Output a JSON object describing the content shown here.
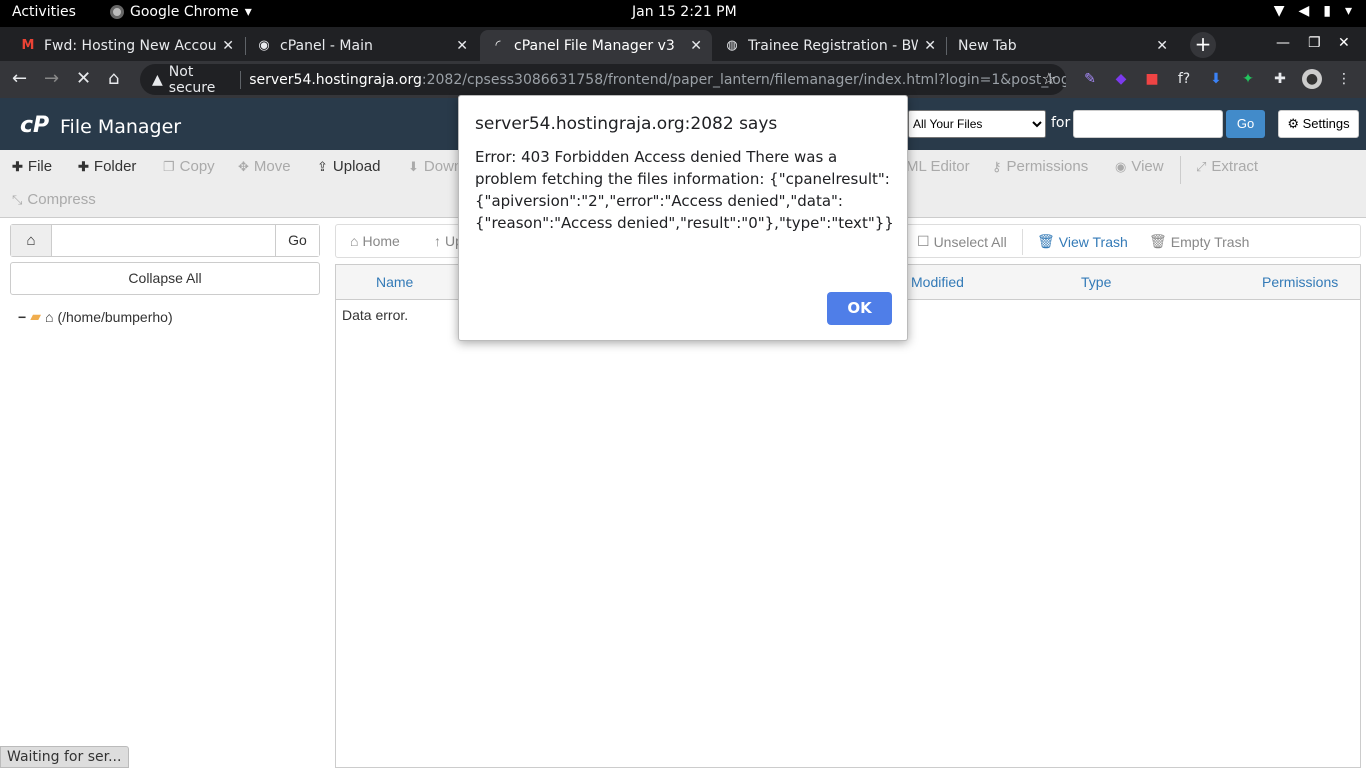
{
  "os": {
    "activities": "Activities",
    "app_name": "Google Chrome",
    "clock": "Jan 15   2:21 PM"
  },
  "tabs": [
    {
      "title": "Fwd: Hosting New Accou",
      "icon": "gmail-icon"
    },
    {
      "title": "cPanel - Main",
      "icon": "globe-icon"
    },
    {
      "title": "cPanel File Manager v3",
      "icon": "loading-icon"
    },
    {
      "title": "Trainee Registration - BW",
      "icon": "site-icon"
    },
    {
      "title": "New Tab",
      "icon": ""
    }
  ],
  "omnibox": {
    "security": "Not secure",
    "host": "server54.hostingraja.org",
    "path": ":2082/cpsess3086631758/frontend/paper_lantern/filemanager/index.html?login=1&post_login..."
  },
  "cpanel": {
    "logo": "cP",
    "title": "File Manager",
    "search_scope": "All Your Files",
    "for_label": "for",
    "go_label": "Go",
    "settings_label": "Settings"
  },
  "actions": {
    "file": "File",
    "folder": "Folder",
    "copy": "Copy",
    "move": "Move",
    "upload": "Upload",
    "download": "Down",
    "html_editor": "ML Editor",
    "permissions": "Permissions",
    "view": "View",
    "extract": "Extract",
    "compress": "Compress"
  },
  "left": {
    "go_label": "Go",
    "collapse_all": "Collapse All",
    "tree_root": "(/home/bumperho)"
  },
  "right": {
    "home": "Home",
    "up": "Up",
    "unselect_all": "Unselect All",
    "view_trash": "View Trash",
    "empty_trash": "Empty Trash",
    "columns": {
      "name": "Name",
      "modified": "Modified",
      "type": "Type",
      "permissions": "Permissions"
    },
    "data_error": "Data error."
  },
  "status_bar": "Waiting for ser...",
  "dialog": {
    "origin": "server54.hostingraja.org:2082 says",
    "message": "Error: 403 Forbidden Access denied There was a problem fetching the files information: {\"cpanelresult\":{\"apiversion\":\"2\",\"error\":\"Access denied\",\"data\":{\"reason\":\"Access denied\",\"result\":\"0\"},\"type\":\"text\"}}",
    "ok_label": "OK"
  },
  "colors": {
    "cpanel_header": "#293a4a",
    "link_blue": "#337ab7",
    "ok_button": "#4f7ee8"
  }
}
